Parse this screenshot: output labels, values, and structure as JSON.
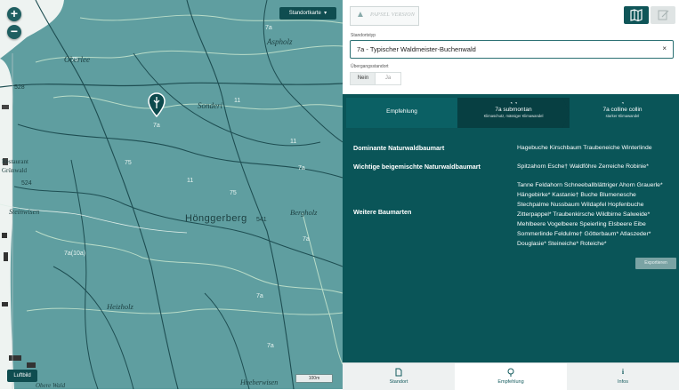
{
  "map": {
    "switch_label": "Standortkarte",
    "luftbild_label": "Luftbild",
    "scale_label": "100m",
    "zoom_in": "+",
    "zoom_out": "−",
    "place_labels": [
      "Oberlee",
      "Aspholz",
      "Sonderi",
      "Restaurant",
      "Grünwald",
      "Steinwisen",
      "Hönggerberg",
      "541",
      "Bergholz",
      "Heizholz",
      "Hueberwisen",
      "Obere Wald"
    ],
    "codes": [
      "75",
      "7a",
      "11",
      "11",
      "7a",
      "75",
      "7a(10a)",
      "7a",
      "7a",
      "11",
      "528",
      "524",
      "75",
      "7a"
    ],
    "marker_code": "7a"
  },
  "panel": {
    "logo_text": "PAPSEL VERSION",
    "standorttyp_label": "Standortstyp",
    "standorttyp_value": "7a - Typischer Waldmeister-Buchenwald",
    "clear_icon": "×",
    "uebergang_label": "Übergangsstandort",
    "toggle_no": "Nein",
    "toggle_yes": "Ja",
    "tabs": [
      {
        "title": "Empfehlung",
        "sub": ""
      },
      {
        "title": "7a submontan",
        "sub": "Klimaschutz, mässiger Klimawandel"
      },
      {
        "title": "7a colline collin",
        "sub": "starker Klimawandel"
      }
    ],
    "rows": [
      {
        "label": "Dominante Naturwaldbaumart",
        "lines": [
          "Hagebuche Kirschbaum Traubeneiche Winterlinde"
        ]
      },
      {
        "label": "Wichtige beigemischte Naturwaldbaumart",
        "lines": [
          "Spitzahorn Esche† Waldföhre Zerreiche Robinie*"
        ]
      },
      {
        "label": "Weitere Baumarten",
        "lines": [
          "Tanne Feldahorn Schneeballblättriger Ahorn Grauerle*",
          "Hängebirke* Kastanie† Buche Blumenesche",
          "Stechpalme Nussbaum Wildapfel Hopfenbuche",
          "Zitterpappel* Traubenkirsche Wildbirne Salweide*",
          "Mehlbeere Vogelbeere Speierling Elsbeere Eibe",
          "Sommerlinde Feldulme† Götterbaum* Atlaszeder*",
          "Douglasie* Steineiche* Roteiche*"
        ]
      }
    ],
    "export_label": "Exportieren"
  },
  "bottom_nav": [
    {
      "label": "Standort",
      "icon": "document-icon"
    },
    {
      "label": "Empfehlung",
      "icon": "tree-icon"
    },
    {
      "label": "Infos",
      "icon": "info-icon"
    }
  ],
  "colors": {
    "teal_dark": "#0a5558",
    "teal_map": "#5f9ea0",
    "accent": "#0f5558"
  }
}
